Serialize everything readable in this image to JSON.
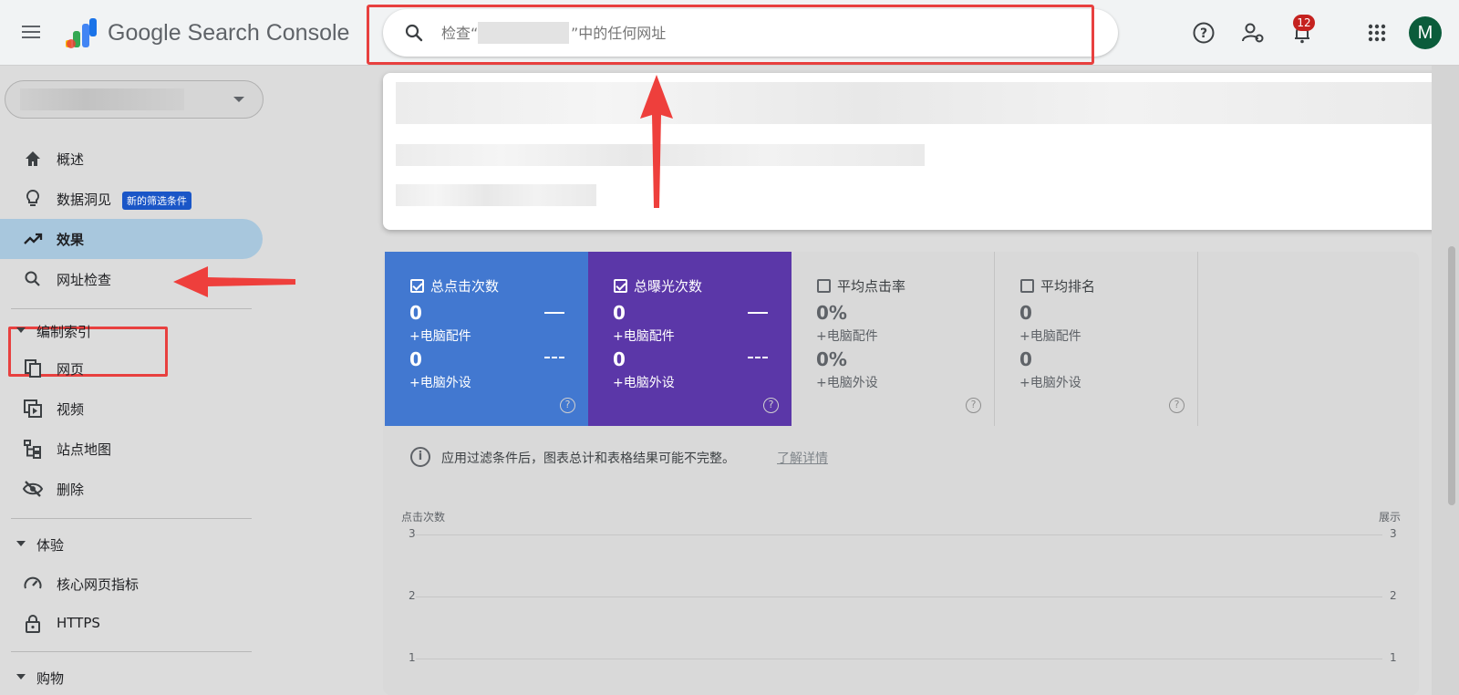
{
  "header": {
    "app_name": "Google Search Console",
    "search_placeholder": "检查“                    ”中的任何网址",
    "notifications_count": "12",
    "avatar_letter": "M"
  },
  "sidebar": {
    "items": [
      {
        "label": "概述",
        "icon": "home-icon"
      },
      {
        "label": "数据洞见",
        "icon": "lightbulb-icon",
        "chip": "新的筛选条件"
      },
      {
        "label": "效果",
        "icon": "trending-up-icon",
        "active": true
      },
      {
        "label": "网址检查",
        "icon": "search-icon"
      }
    ],
    "sections": [
      {
        "label": "编制索引",
        "items": [
          {
            "label": "网页",
            "icon": "pages-icon"
          },
          {
            "label": "视频",
            "icon": "video-icon"
          },
          {
            "label": "站点地图",
            "icon": "sitemap-icon"
          },
          {
            "label": "删除",
            "icon": "hidden-eye-icon"
          }
        ]
      },
      {
        "label": "体验",
        "items": [
          {
            "label": "核心网页指标",
            "icon": "speed-gauge-icon"
          },
          {
            "label": "HTTPS",
            "icon": "lock-icon"
          }
        ]
      },
      {
        "label": "购物",
        "items": []
      }
    ]
  },
  "metrics": [
    {
      "title": "总点击次数",
      "checked": true,
      "color": "#4278d0",
      "value1": "0",
      "sub1": "+电脑配件",
      "value2": "0",
      "sub2": "+电脑外设"
    },
    {
      "title": "总曝光次数",
      "checked": true,
      "color": "#5b37a8",
      "value1": "0",
      "sub1": "+电脑配件",
      "value2": "0",
      "sub2": "+电脑外设"
    },
    {
      "title": "平均点击率",
      "checked": false,
      "color": "#d9d9d9",
      "value1": "0%",
      "sub1": "+电脑配件",
      "value2": "0%",
      "sub2": "+电脑外设"
    },
    {
      "title": "平均排名",
      "checked": false,
      "color": "#d9d9d9",
      "value1": "0",
      "sub1": "+电脑配件",
      "value2": "0",
      "sub2": "+电脑外设"
    }
  ],
  "notice": {
    "text": "应用过滤条件后，图表总计和表格结果可能不完整。",
    "link": "了解详情"
  },
  "chart_data": {
    "type": "line",
    "y_left_label": "点击次数",
    "y_right_label": "展示",
    "y_left_ticks": [
      "3",
      "2",
      "1"
    ],
    "y_right_ticks": [
      "3",
      "2",
      "1"
    ],
    "ylim": [
      0,
      3
    ],
    "series": []
  },
  "colors": {
    "annotation_red": "#e8403f",
    "clicks_blue": "#4278d0",
    "impressions_purple": "#5b37a8"
  }
}
